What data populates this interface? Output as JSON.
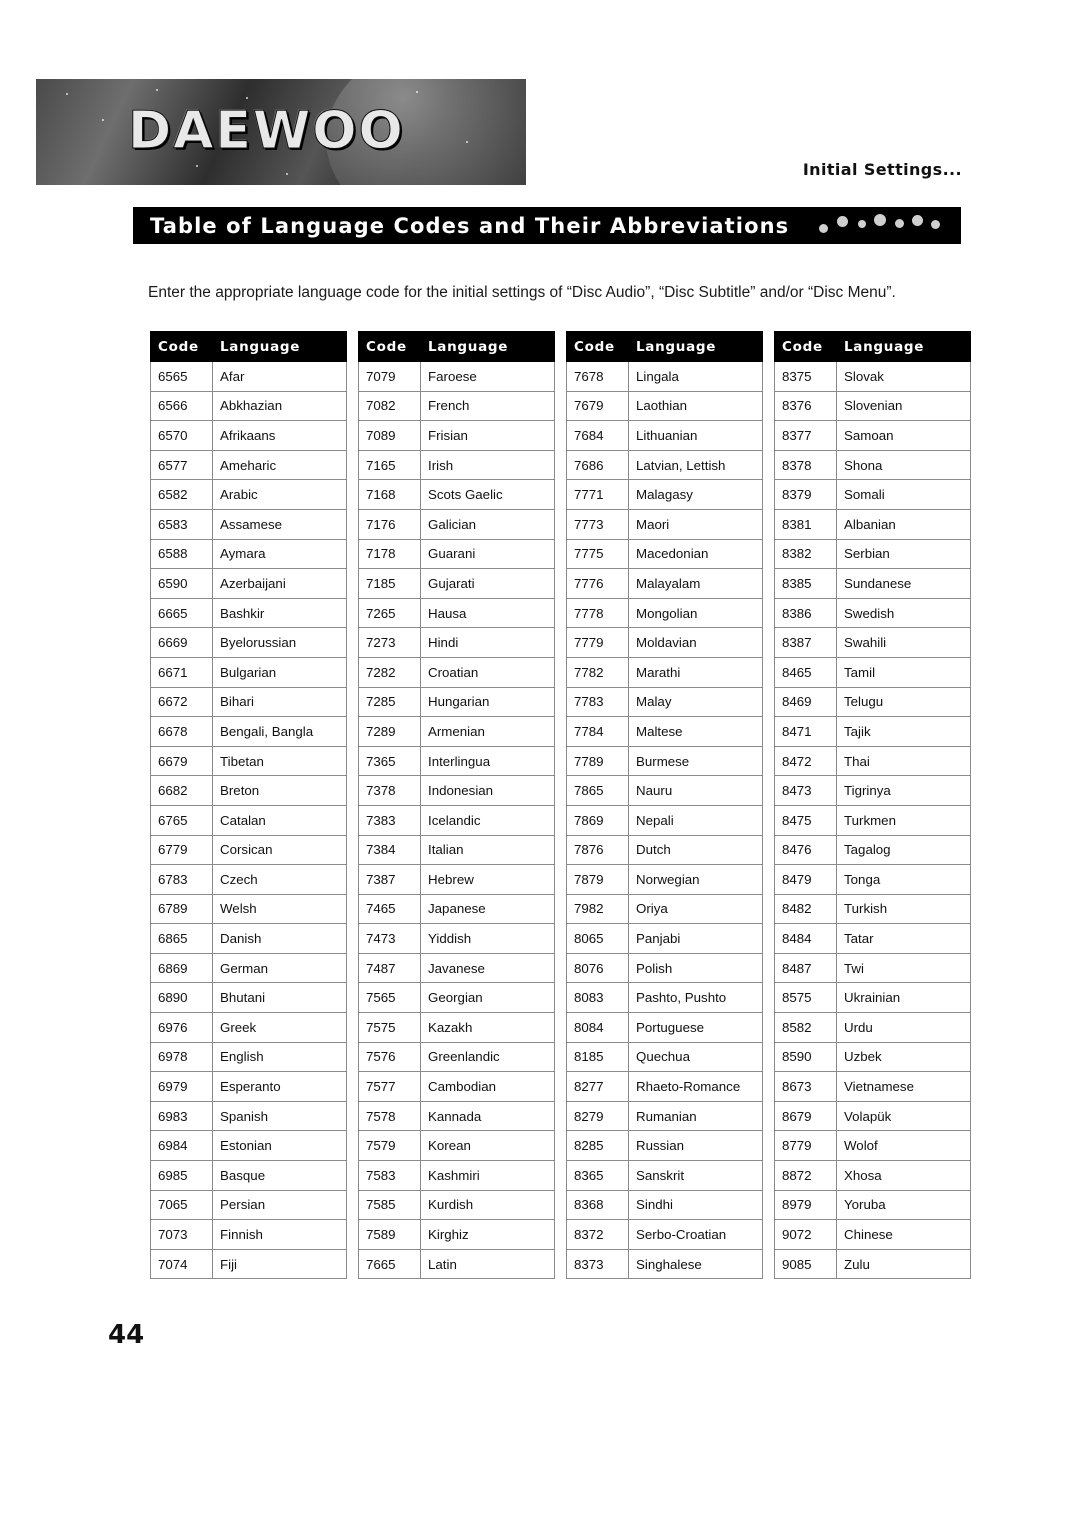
{
  "header": {
    "logo_text": "DAEWOO",
    "section_label": "Initial Settings...",
    "title": "Table of Language Codes and Their Abbreviations"
  },
  "intro": "Enter the appropriate language code for the initial settings of “Disc Audio”, “Disc Subtitle” and/or “Disc Menu”.",
  "page_number": "44",
  "columns": {
    "code_header": "Code",
    "language_header": "Language"
  },
  "tables": [
    {
      "rows": [
        [
          "6565",
          "Afar"
        ],
        [
          "6566",
          "Abkhazian"
        ],
        [
          "6570",
          "Afrikaans"
        ],
        [
          "6577",
          "Ameharic"
        ],
        [
          "6582",
          "Arabic"
        ],
        [
          "6583",
          "Assamese"
        ],
        [
          "6588",
          "Aymara"
        ],
        [
          "6590",
          "Azerbaijani"
        ],
        [
          "6665",
          "Bashkir"
        ],
        [
          "6669",
          "Byelorussian"
        ],
        [
          "6671",
          "Bulgarian"
        ],
        [
          "6672",
          "Bihari"
        ],
        [
          "6678",
          "Bengali, Bangla"
        ],
        [
          "6679",
          "Tibetan"
        ],
        [
          "6682",
          "Breton"
        ],
        [
          "6765",
          "Catalan"
        ],
        [
          "6779",
          "Corsican"
        ],
        [
          "6783",
          "Czech"
        ],
        [
          "6789",
          "Welsh"
        ],
        [
          "6865",
          "Danish"
        ],
        [
          "6869",
          "German"
        ],
        [
          "6890",
          "Bhutani"
        ],
        [
          "6976",
          "Greek"
        ],
        [
          "6978",
          "English"
        ],
        [
          "6979",
          "Esperanto"
        ],
        [
          "6983",
          "Spanish"
        ],
        [
          "6984",
          "Estonian"
        ],
        [
          "6985",
          "Basque"
        ],
        [
          "7065",
          "Persian"
        ],
        [
          "7073",
          "Finnish"
        ],
        [
          "7074",
          "Fiji"
        ]
      ]
    },
    {
      "rows": [
        [
          "7079",
          "Faroese"
        ],
        [
          "7082",
          "French"
        ],
        [
          "7089",
          "Frisian"
        ],
        [
          "7165",
          "Irish"
        ],
        [
          "7168",
          "Scots Gaelic"
        ],
        [
          "7176",
          "Galician"
        ],
        [
          "7178",
          "Guarani"
        ],
        [
          "7185",
          "Gujarati"
        ],
        [
          "7265",
          "Hausa"
        ],
        [
          "7273",
          "Hindi"
        ],
        [
          "7282",
          "Croatian"
        ],
        [
          "7285",
          "Hungarian"
        ],
        [
          "7289",
          "Armenian"
        ],
        [
          "7365",
          "Interlingua"
        ],
        [
          "7378",
          "Indonesian"
        ],
        [
          "7383",
          "Icelandic"
        ],
        [
          "7384",
          "Italian"
        ],
        [
          "7387",
          "Hebrew"
        ],
        [
          "7465",
          "Japanese"
        ],
        [
          "7473",
          "Yiddish"
        ],
        [
          "7487",
          "Javanese"
        ],
        [
          "7565",
          "Georgian"
        ],
        [
          "7575",
          "Kazakh"
        ],
        [
          "7576",
          "Greenlandic"
        ],
        [
          "7577",
          "Cambodian"
        ],
        [
          "7578",
          "Kannada"
        ],
        [
          "7579",
          "Korean"
        ],
        [
          "7583",
          "Kashmiri"
        ],
        [
          "7585",
          "Kurdish"
        ],
        [
          "7589",
          "Kirghiz"
        ],
        [
          "7665",
          "Latin"
        ]
      ]
    },
    {
      "rows": [
        [
          "7678",
          "Lingala"
        ],
        [
          "7679",
          "Laothian"
        ],
        [
          "7684",
          "Lithuanian"
        ],
        [
          "7686",
          "Latvian, Lettish"
        ],
        [
          "7771",
          "Malagasy"
        ],
        [
          "7773",
          "Maori"
        ],
        [
          "7775",
          "Macedonian"
        ],
        [
          "7776",
          "Malayalam"
        ],
        [
          "7778",
          "Mongolian"
        ],
        [
          "7779",
          "Moldavian"
        ],
        [
          "7782",
          "Marathi"
        ],
        [
          "7783",
          "Malay"
        ],
        [
          "7784",
          "Maltese"
        ],
        [
          "7789",
          "Burmese"
        ],
        [
          "7865",
          "Nauru"
        ],
        [
          "7869",
          "Nepali"
        ],
        [
          "7876",
          "Dutch"
        ],
        [
          "7879",
          "Norwegian"
        ],
        [
          "7982",
          "Oriya"
        ],
        [
          "8065",
          "Panjabi"
        ],
        [
          "8076",
          "Polish"
        ],
        [
          "8083",
          "Pashto, Pushto"
        ],
        [
          "8084",
          "Portuguese"
        ],
        [
          "8185",
          "Quechua"
        ],
        [
          "8277",
          "Rhaeto-Romance"
        ],
        [
          "8279",
          "Rumanian"
        ],
        [
          "8285",
          "Russian"
        ],
        [
          "8365",
          "Sanskrit"
        ],
        [
          "8368",
          "Sindhi"
        ],
        [
          "8372",
          "Serbo-Croatian"
        ],
        [
          "8373",
          "Singhalese"
        ]
      ]
    },
    {
      "rows": [
        [
          "8375",
          "Slovak"
        ],
        [
          "8376",
          "Slovenian"
        ],
        [
          "8377",
          "Samoan"
        ],
        [
          "8378",
          "Shona"
        ],
        [
          "8379",
          "Somali"
        ],
        [
          "8381",
          "Albanian"
        ],
        [
          "8382",
          "Serbian"
        ],
        [
          "8385",
          "Sundanese"
        ],
        [
          "8386",
          "Swedish"
        ],
        [
          "8387",
          "Swahili"
        ],
        [
          "8465",
          "Tamil"
        ],
        [
          "8469",
          "Telugu"
        ],
        [
          "8471",
          "Tajik"
        ],
        [
          "8472",
          "Thai"
        ],
        [
          "8473",
          "Tigrinya"
        ],
        [
          "8475",
          "Turkmen"
        ],
        [
          "8476",
          "Tagalog"
        ],
        [
          "8479",
          "Tonga"
        ],
        [
          "8482",
          "Turkish"
        ],
        [
          "8484",
          "Tatar"
        ],
        [
          "8487",
          "Twi"
        ],
        [
          "8575",
          "Ukrainian"
        ],
        [
          "8582",
          "Urdu"
        ],
        [
          "8590",
          "Uzbek"
        ],
        [
          "8673",
          "Vietnamese"
        ],
        [
          "8679",
          "Volapük"
        ],
        [
          "8779",
          "Wolof"
        ],
        [
          "8872",
          "Xhosa"
        ],
        [
          "8979",
          "Yoruba"
        ],
        [
          "9072",
          "Chinese"
        ],
        [
          "9085",
          "Zulu"
        ]
      ]
    }
  ]
}
